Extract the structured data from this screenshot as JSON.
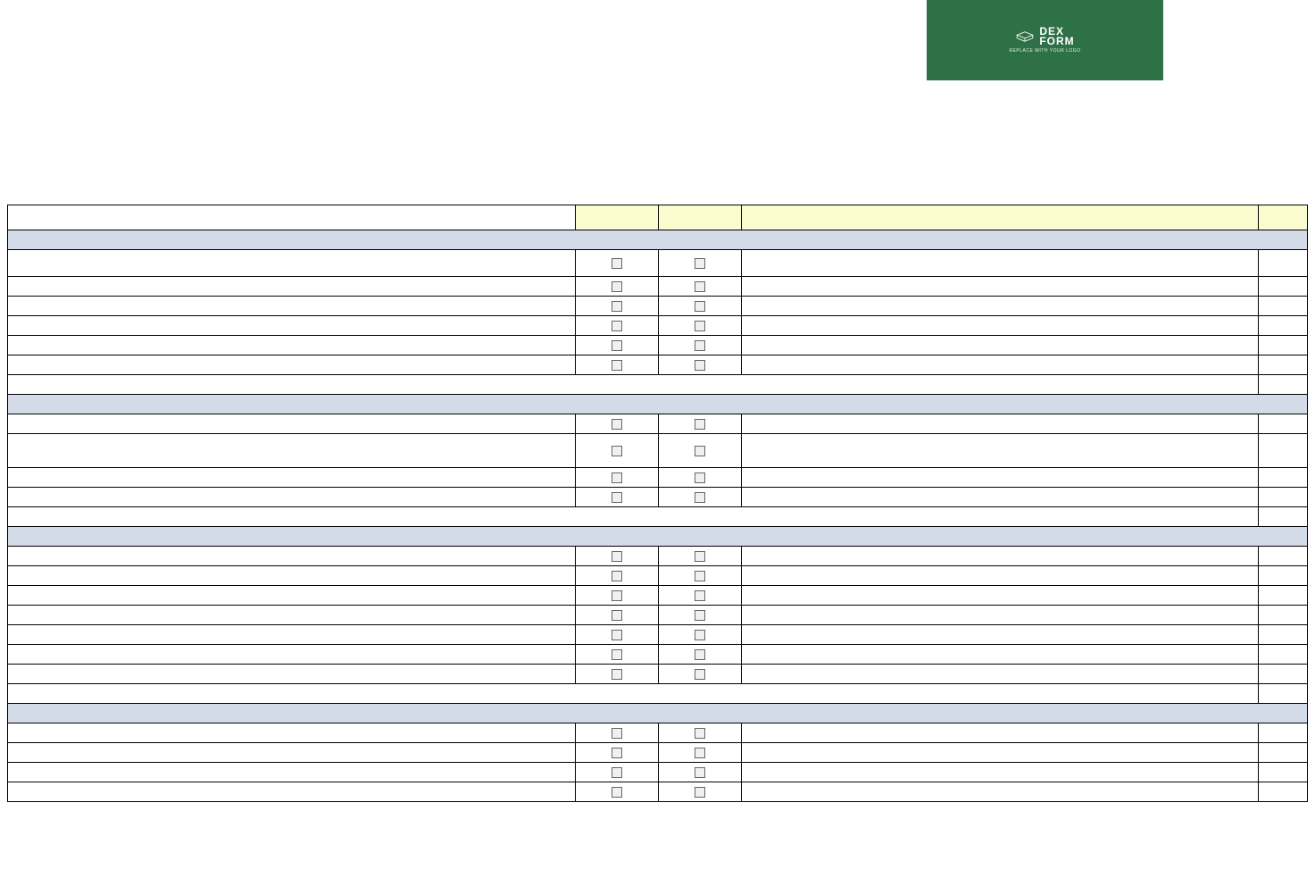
{
  "logo": {
    "line1": "DEX",
    "line2": "FORM",
    "sub": "REPLACE WITH YOUR LOGO"
  },
  "headers": {
    "desc": "",
    "yes": "",
    "no": "",
    "comments": "",
    "init": ""
  },
  "sections": [
    {
      "title": "",
      "rows": [
        {
          "label": "",
          "tall": true
        },
        {
          "label": ""
        },
        {
          "label": ""
        },
        {
          "label": ""
        },
        {
          "label": ""
        },
        {
          "label": ""
        }
      ]
    },
    {
      "title": "",
      "rows": [
        {
          "label": ""
        },
        {
          "label": "",
          "taller": true
        },
        {
          "label": ""
        },
        {
          "label": ""
        }
      ]
    },
    {
      "title": "",
      "rows": [
        {
          "label": ""
        },
        {
          "label": ""
        },
        {
          "label": ""
        },
        {
          "label": ""
        },
        {
          "label": ""
        },
        {
          "label": ""
        },
        {
          "label": ""
        }
      ]
    },
    {
      "title": "",
      "rows": [
        {
          "label": ""
        },
        {
          "label": ""
        },
        {
          "label": ""
        },
        {
          "label": ""
        }
      ]
    }
  ]
}
